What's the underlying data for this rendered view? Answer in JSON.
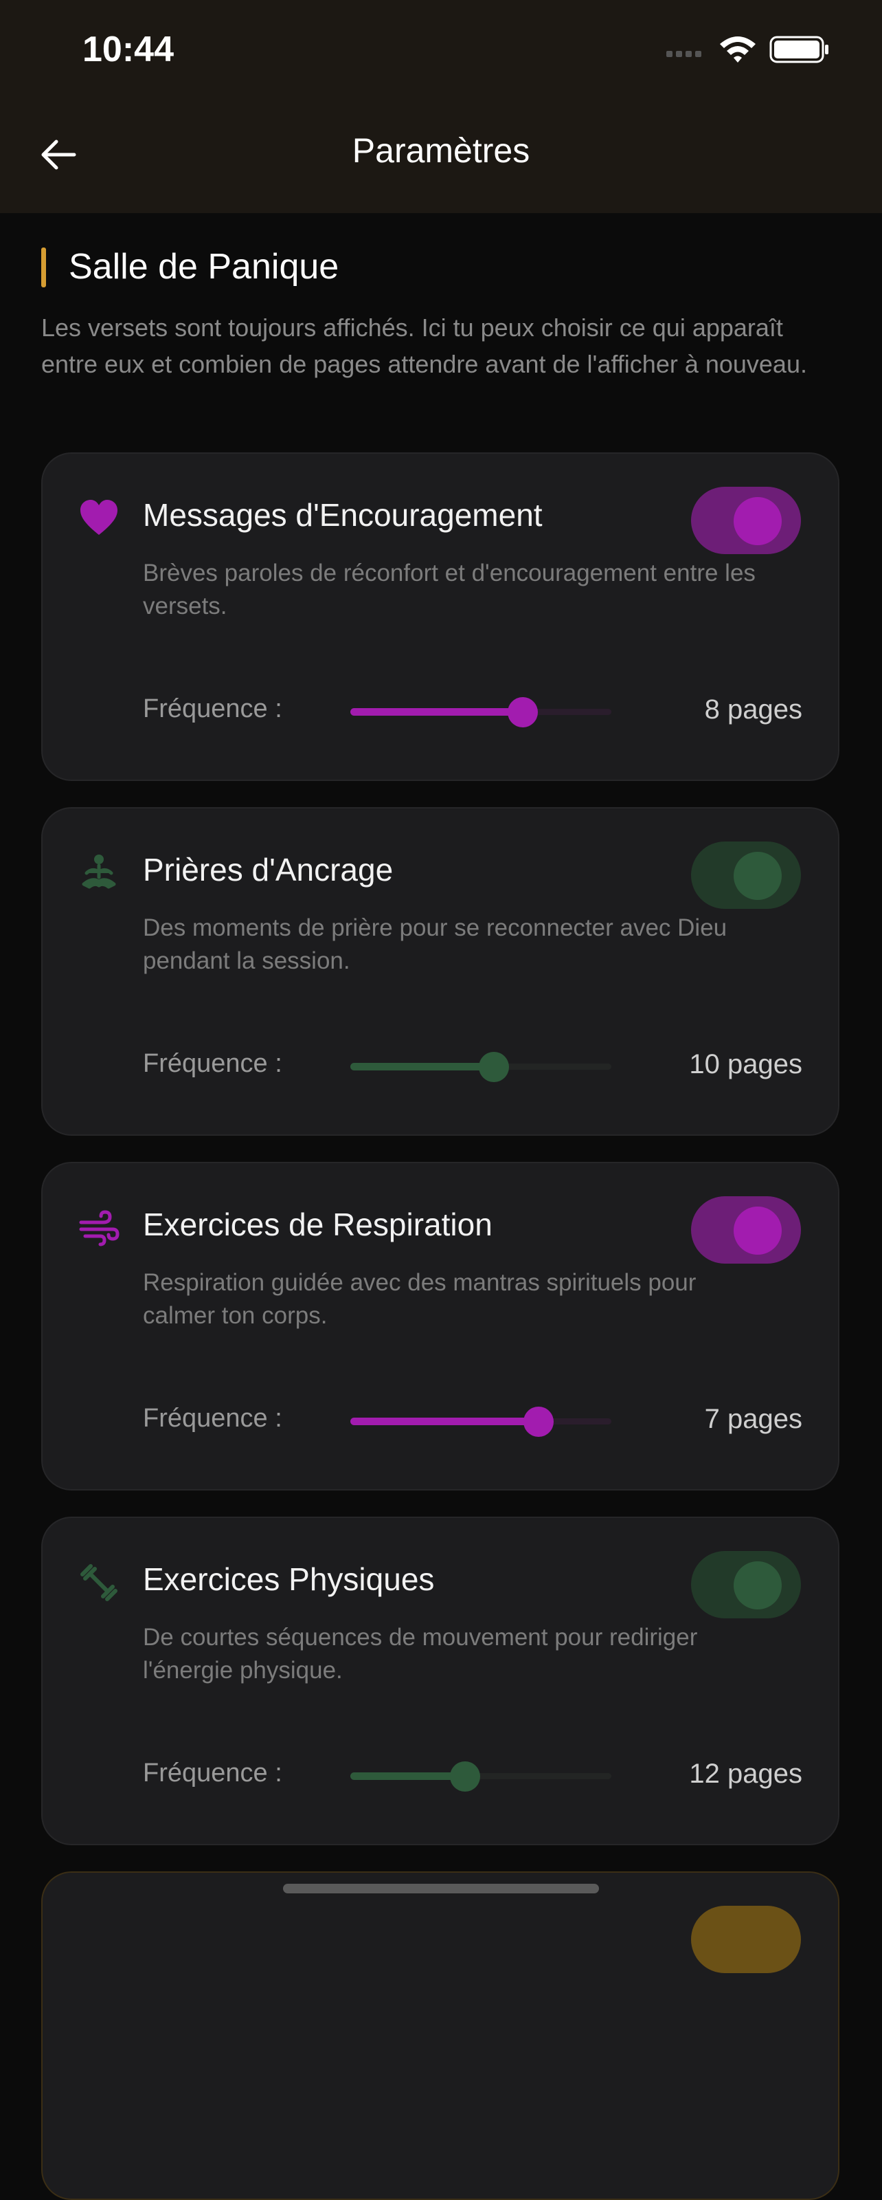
{
  "status": {
    "time": "10:44"
  },
  "nav": {
    "title": "Paramètres"
  },
  "section": {
    "title": "Salle de Panique",
    "description": "Les versets sont toujours affichés. Ici tu peux choisir ce qui apparaît entre eux et combien de pages attendre avant de l'afficher à nouveau."
  },
  "colors": {
    "accent_gold": "#d69d32",
    "on_track": "#6d1e77",
    "on_knob": "#a21caf",
    "off_track": "#223a29",
    "off_knob": "#2e5a3b"
  },
  "cards": [
    {
      "icon": "heart-icon",
      "title": "Messages d'Encouragement",
      "description": "Brèves paroles de réconfort et d'encouragement entre les versets.",
      "enabled": true,
      "freq_label": "Fréquence :",
      "freq_value": "8 pages",
      "slider_fraction": 0.66
    },
    {
      "icon": "meditation-icon",
      "title": "Prières d'Ancrage",
      "description": "Des moments de prière pour se reconnecter avec Dieu pendant la session.",
      "enabled": false,
      "freq_label": "Fréquence :",
      "freq_value": "10 pages",
      "slider_fraction": 0.55
    },
    {
      "icon": "wind-icon",
      "title": "Exercices de Respiration",
      "description": "Respiration guidée avec des mantras spirituels pour calmer ton corps.",
      "enabled": true,
      "freq_label": "Fréquence :",
      "freq_value": "7 pages",
      "slider_fraction": 0.72
    },
    {
      "icon": "dumbbell-icon",
      "title": "Exercices Physiques",
      "description": "De courtes séquences de mouvement pour rediriger l'énergie physique.",
      "enabled": false,
      "freq_label": "Fréquence :",
      "freq_value": "12 pages",
      "slider_fraction": 0.44
    }
  ]
}
